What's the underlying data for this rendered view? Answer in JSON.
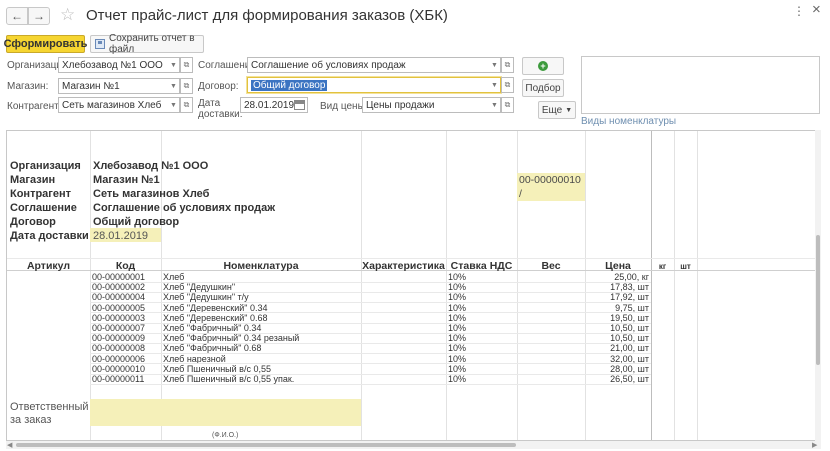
{
  "window": {
    "title": "Отчет прайс-лист для формирования заказов (ХБК)",
    "back_icon": "←",
    "forward_icon": "→",
    "star_icon": "☆",
    "menu_icon": "⋮",
    "close_icon": "×"
  },
  "toolbar": {
    "generate_label": "Сформировать",
    "save_label": "Сохранить отчет в файл"
  },
  "form": {
    "organization_label": "Организация:",
    "organization_value": "Хлебозавод №1 ООО",
    "shop_label": "Магазин:",
    "shop_value": "Магазин №1",
    "counterparty_label": "Контрагент:",
    "counterparty_value": "Сеть магазинов Хлеб",
    "agreement_label": "Соглашение:",
    "agreement_value": "Соглашение об условиях продаж",
    "contract_label": "Договор:",
    "contract_value": "Общий договор",
    "delivery_label_1": "Дата",
    "delivery_label_2": "доставки:",
    "delivery_value": "28.01.2019",
    "price_type_label": "Вид цены:",
    "price_type_value": "Цены продажи",
    "pick_label": "Подбор",
    "more_label": "Еще",
    "add_icon": "+",
    "types_label": "Виды номенклатуры"
  },
  "report": {
    "info": [
      {
        "label": "Организация",
        "value": "Хлебозавод №1 ООО"
      },
      {
        "label": "Магазин",
        "value": "Магазин №1"
      },
      {
        "label": "Контрагент",
        "value": "Сеть магазинов Хлеб"
      },
      {
        "label": "Соглашение",
        "value": "Соглашение об условиях продаж"
      },
      {
        "label": "Договор",
        "value": "Общий договор"
      },
      {
        "label": "Дата доставки",
        "value": "28.01.2019"
      }
    ],
    "side_code": "00-00000010",
    "side_slash": "/",
    "columns": {
      "article": "Артикул",
      "code": "Код",
      "nomenclature": "Номенклатура",
      "characteristic": "Характеристика",
      "vat": "Ставка НДС",
      "weight": "Вес",
      "price": "Цена",
      "kg": "кг",
      "pcs": "шт"
    },
    "rows": [
      {
        "code": "00-00000001",
        "name": "Хлеб",
        "vat": "10%",
        "price": "25,00, кг"
      },
      {
        "code": "00-00000002",
        "name": "Хлеб \"Дедушкин\"",
        "vat": "10%",
        "price": "17,83, шт"
      },
      {
        "code": "00-00000004",
        "name": "Хлеб \"Дедушкин\" т/у",
        "vat": "10%",
        "price": "17,92, шт"
      },
      {
        "code": "00-00000005",
        "name": "Хлеб \"Деревенский\" 0.34",
        "vat": "10%",
        "price": "9,75, шт"
      },
      {
        "code": "00-00000003",
        "name": "Хлеб \"Деревенский\" 0.68",
        "vat": "10%",
        "price": "19,50, шт"
      },
      {
        "code": "00-00000007",
        "name": "Хлеб \"Фабричный\" 0.34",
        "vat": "10%",
        "price": "10,50, шт"
      },
      {
        "code": "00-00000009",
        "name": "Хлеб \"Фабричный\" 0.34 резаный",
        "vat": "10%",
        "price": "10,50, шт"
      },
      {
        "code": "00-00000008",
        "name": "Хлеб \"Фабричный\" 0.68",
        "vat": "10%",
        "price": "21,00, шт"
      },
      {
        "code": "00-00000006",
        "name": "Хлеб нарезной",
        "vat": "10%",
        "price": "32,00, шт"
      },
      {
        "code": "00-00000010",
        "name": "Хлеб Пшеничный в/с 0,55",
        "vat": "10%",
        "price": "28,00, шт"
      },
      {
        "code": "00-00000011",
        "name": "Хлеб Пшеничный в/с 0,55 упак.",
        "vat": "10%",
        "price": "26,50, шт"
      }
    ],
    "responsible_1": "Ответственный",
    "responsible_2": "за заказ",
    "fio_caption": "(Ф.И.О.)"
  }
}
